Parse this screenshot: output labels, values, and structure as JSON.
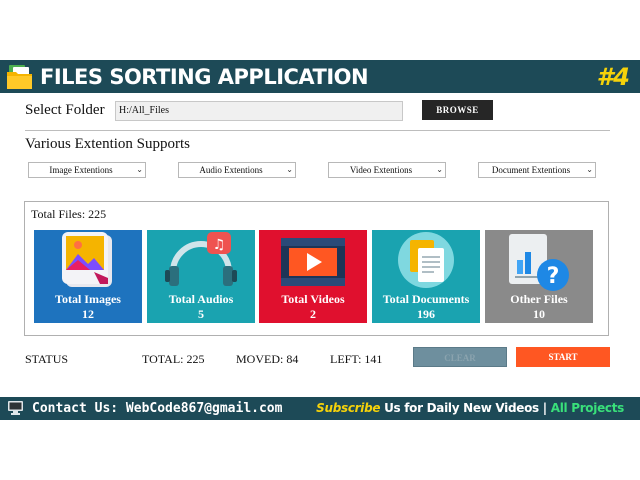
{
  "header": {
    "title": "FILES SORTING APPLICATION",
    "episode": "#4",
    "colors": {
      "bar": "#1d4a57",
      "episode": "#f5d20a"
    }
  },
  "folder": {
    "label": "Select Folder",
    "path": "H:/All_Files",
    "browse_label": "BROWSE"
  },
  "extensions": {
    "label": "Various Extention Supports",
    "dropdowns": [
      {
        "selected": "Image Extentions"
      },
      {
        "selected": "Audio Extentions"
      },
      {
        "selected": "Video Extentions"
      },
      {
        "selected": "Document Extentions"
      }
    ]
  },
  "files": {
    "total_label": "Total Files: 225",
    "tiles": [
      {
        "name": "Total Images",
        "count": "12",
        "color": "#1e73be",
        "icon": "image-icon"
      },
      {
        "name": "Total Audios",
        "count": "5",
        "color": "#1aa3b0",
        "icon": "headphones-icon"
      },
      {
        "name": "Total Videos",
        "count": "2",
        "color": "#e0102e",
        "icon": "video-play-icon"
      },
      {
        "name": "Total Documents",
        "count": "196",
        "color": "#1aa3b0",
        "icon": "documents-icon"
      },
      {
        "name": "Other Files",
        "count": "10",
        "color": "#8a8a8a",
        "icon": "unknown-file-icon"
      }
    ]
  },
  "status_bar": {
    "status": "STATUS",
    "total": "TOTAL: 225",
    "moved": "MOVED: 84",
    "left": "LEFT: 141",
    "clear_label": "CLEAR",
    "start_label": "START",
    "colors": {
      "clear": "#6e8f9e",
      "start": "#ff5722"
    }
  },
  "footer": {
    "contact": "Contact Us: WebCode867@gmail.com",
    "subscribe_word": "Subscribe",
    "subscribe_rest": " Us for Daily New Videos | ",
    "all_projects": "All Projects"
  }
}
